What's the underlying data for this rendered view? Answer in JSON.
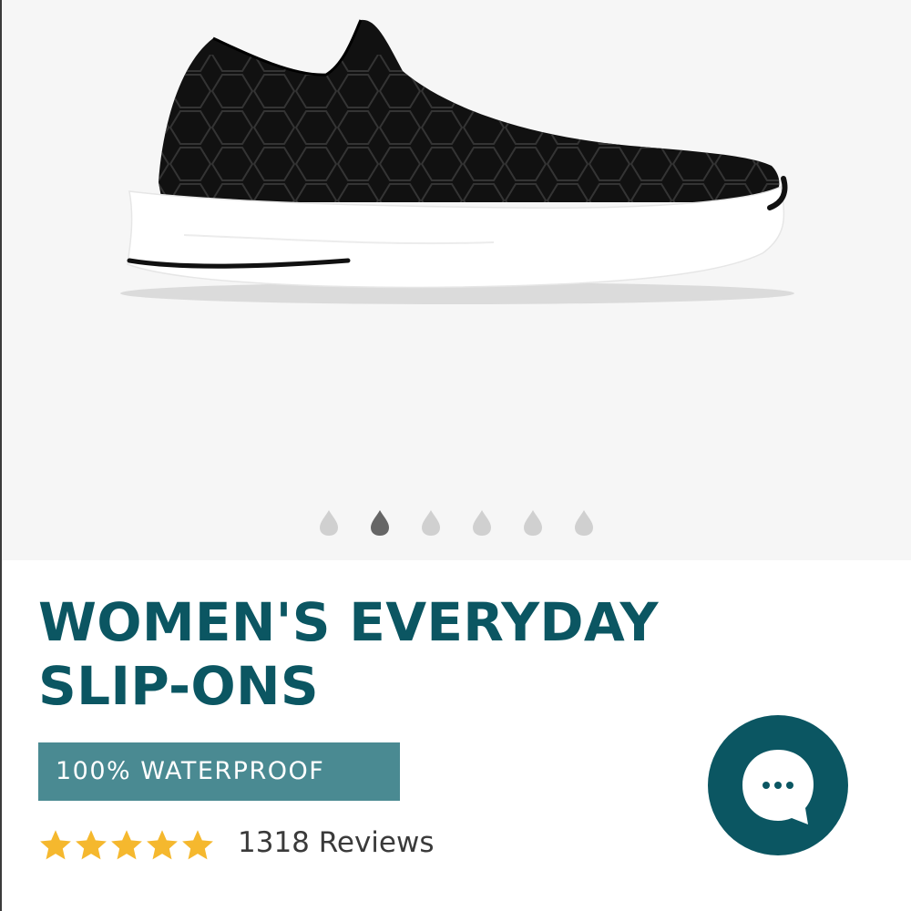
{
  "product": {
    "title_line1": "WOMEN'S EVERYDAY",
    "title_line2": "SLIP-ONS",
    "badge": "100% WATERPROOF",
    "image_alt": "Black knit slip-on sneaker with white sole"
  },
  "carousel": {
    "dot_count": 6,
    "active_index": 1
  },
  "rating": {
    "stars": 5,
    "reviews_label": "1318 Reviews"
  },
  "chat": {
    "icon": "chat-bubble-ellipsis-icon"
  },
  "colors": {
    "brand_teal": "#0b5662",
    "badge_teal": "#4a8a92",
    "star_gold": "#f5b82e",
    "dot_inactive": "#d0d0d0",
    "dot_active": "#666666"
  }
}
